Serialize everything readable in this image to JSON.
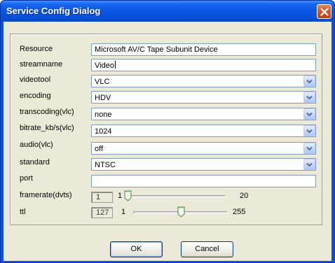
{
  "window": {
    "title": "Service Config Dialog"
  },
  "fields": {
    "resource": {
      "label": "Resource",
      "value": "Microsoft AV/C Tape Subunit Device"
    },
    "streamname": {
      "label": "streamname",
      "value": "Video"
    },
    "videotool": {
      "label": "videotool",
      "value": "VLC"
    },
    "encoding": {
      "label": "encoding",
      "value": "HDV"
    },
    "transcoding": {
      "label": "transcoding(vlc)",
      "value": "none"
    },
    "bitrate": {
      "label": "bitrate_kb/s(vlc)",
      "value": "1024"
    },
    "audio": {
      "label": "audio(vlc)",
      "value": "off"
    },
    "standard": {
      "label": "standard",
      "value": "NTSC"
    },
    "port": {
      "label": "port",
      "value": ""
    },
    "framerate": {
      "label": "framerate(dvts)",
      "value": "1",
      "min": "1",
      "max": "20",
      "level": 0.0
    },
    "ttl": {
      "label": "ttl",
      "value": "127",
      "min": "1",
      "max": "255",
      "level": 0.5
    }
  },
  "buttons": {
    "ok": "OK",
    "cancel": "Cancel"
  },
  "icons": {
    "close": "close-icon",
    "dropdown": "chevron-down-icon"
  },
  "colors": {
    "title_bar": "#0a58e4",
    "close_button": "#d9532e",
    "dialog_face": "#ece9d8",
    "field_border": "#7f9db9"
  }
}
